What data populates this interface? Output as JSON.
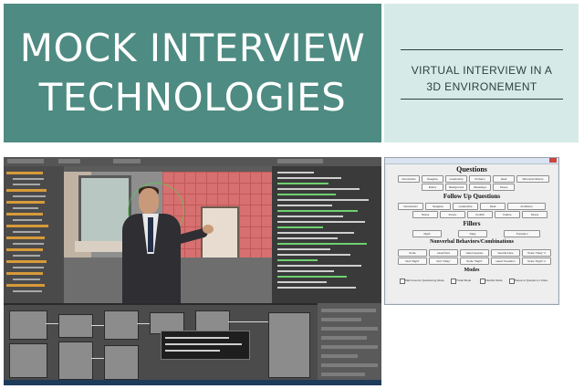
{
  "banner": {
    "title_line1": "MOCK INTERVIEW",
    "title_line2": "TECHNOLOGIES"
  },
  "subtitle": {
    "line1": "VIRTUAL INTERVIEW IN A",
    "line2": "3D ENVIRONEMENT"
  },
  "colors": {
    "banner_bg": "#4e8b82",
    "subtitle_bg": "#d6ebe7",
    "wall": "#d77070",
    "gui_bg": "#eeeeee"
  },
  "gui": {
    "questions_heading": "Questions",
    "follow_up_heading": "Follow Up Questions",
    "fillers_heading": "Fillers",
    "nonverbal_heading": "Nonverbal Behaviors/Combinations",
    "modes_heading": "Modes",
    "questions_buttons": [
      "Introduction",
      "Neagtive",
      "Leadership",
      "Problem",
      "Ideal",
      "Where/Ambitions",
      "Ethics",
      "Background",
      "Weekdays",
      "Stress"
    ],
    "follow_up_buttons": [
      "Introduction",
      "Neagtive",
      "Leadership",
      "Ideal",
      "Ambitions",
      "Stress",
      "Future",
      "Conflict",
      "Failure",
      "Stress"
    ],
    "fillers_buttons": [
      "Right",
      "Okay",
      "Transition"
    ],
    "nonverbal_buttons": [
      "Smile",
      "Head Nod",
      "Hand Gesture",
      "Neutral Face",
      "Nod \"Right\"",
      "Nod \"Okay\"",
      "Smile \"Right\"",
      "Head Transition",
      "Smile \"Right\" 2",
      "Smile \"Okay\" 2"
    ],
    "modes": [
      "Matt Inventor Questioning Mode",
      "Trivial Mode",
      "Flexible Mode",
      "Pause to Question in Video"
    ]
  }
}
